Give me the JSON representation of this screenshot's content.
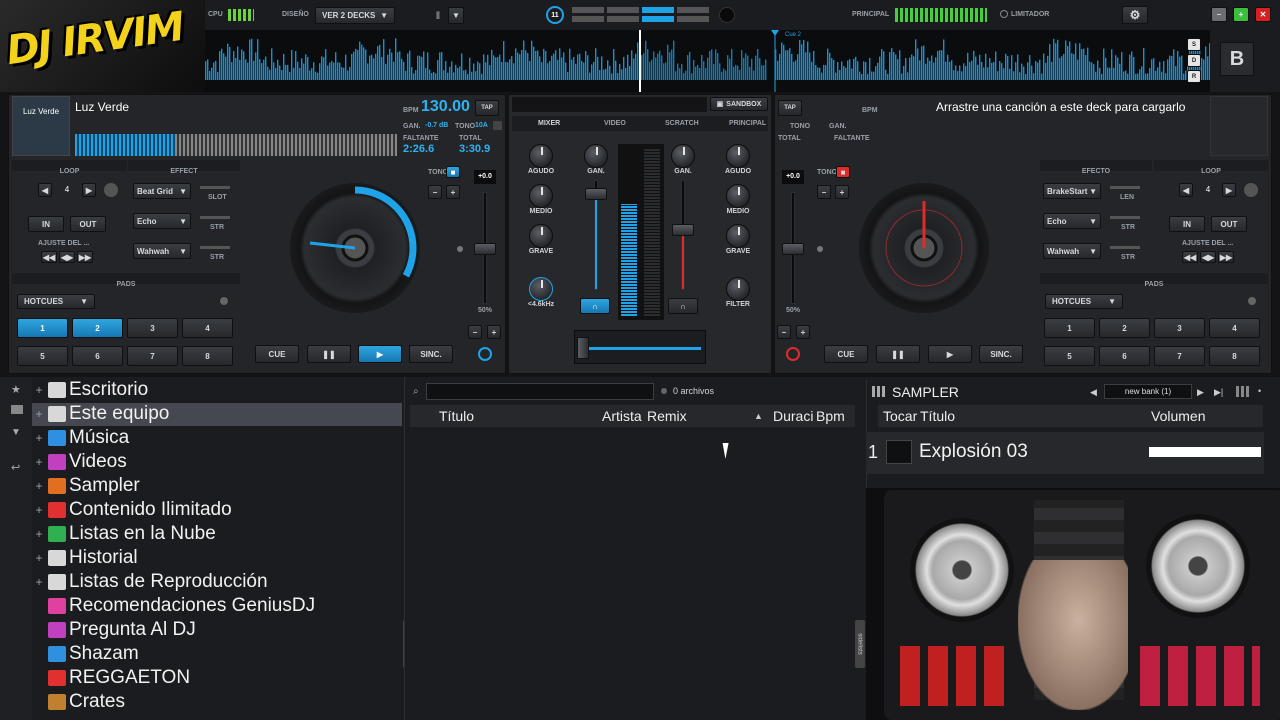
{
  "logo": {
    "text": "DJ IRVIM"
  },
  "topbar": {
    "cpu_label": "CPU",
    "design_label": "DISEÑO",
    "design_value": "VER 2 DECKS",
    "crossfader_number": "11",
    "master_label": "PRINCIPAL",
    "limiter_label": "LIMITADOR",
    "b_label": "B",
    "side_buttons": [
      "S",
      "D",
      "R"
    ],
    "cue_marker": "Cue 2"
  },
  "deck_left": {
    "cover_text": "Luz Verde",
    "title": "Luz Verde",
    "bpm_label": "BPM",
    "bpm_value": "130.00",
    "tap": "TAP",
    "gain_label": "GAN.",
    "gain_value": "-0.7 dB",
    "key_label": "TONO",
    "key_value": "10A",
    "remaining_label": "FALTANTE",
    "remaining_value": "2:26.6",
    "total_label": "TOTAL",
    "total_value": "3:30.9",
    "loop_label": "LOOP",
    "loop_value": "4",
    "in": "IN",
    "out": "OUT",
    "adjust_label": "AJUSTE DEL ...",
    "effect_label": "EFFECT",
    "effects": [
      {
        "name": "Beat Grid",
        "param": "SLOT"
      },
      {
        "name": "Echo",
        "param": "STR"
      },
      {
        "name": "Wahwah",
        "param": "STR"
      }
    ],
    "pads_label": "PADS",
    "pads_mode": "HOTCUES",
    "pads": [
      "1",
      "2",
      "3",
      "4",
      "5",
      "6",
      "7",
      "8"
    ],
    "pitch_label": "TONO",
    "pitch_value": "+0.0",
    "pitch_pct": "50%",
    "cue": "CUE",
    "pause": "❚❚",
    "play": "▶",
    "sync": "SINC."
  },
  "mixer": {
    "sandbox": "SANDBOX",
    "tabs": [
      "MIXER",
      "VIDEO",
      "SCRATCH",
      "PRINCIPAL"
    ],
    "left_knobs": [
      "AGUDO",
      "MEDIO",
      "GRAVE"
    ],
    "left_filter": "<4.6kHz",
    "gain_label": "GAN.",
    "right_knobs": [
      "AGUDO",
      "MEDIO",
      "GRAVE"
    ],
    "right_filter": "FILTER"
  },
  "deck_right": {
    "tap": "TAP",
    "bpm_label": "BPM",
    "key_label": "TONO",
    "gain_label": "GAN.",
    "total_label": "TOTAL",
    "remaining_label": "FALTANTE",
    "empty_message": "Arrastre una canción a este deck para cargarlo",
    "effect_label": "EFECTO",
    "effects": [
      {
        "name": "BrakeStart",
        "param": "LEN"
      },
      {
        "name": "Echo",
        "param": "STR"
      },
      {
        "name": "Wahwah",
        "param": "STR"
      }
    ],
    "loop_label": "LOOP",
    "loop_value": "4",
    "in": "IN",
    "out": "OUT",
    "adjust_label": "AJUSTE DEL ...",
    "pads_label": "PADS",
    "pads_mode": "HOTCUES",
    "pads": [
      "1",
      "2",
      "3",
      "4",
      "5",
      "6",
      "7",
      "8"
    ],
    "pitch_label": "TONO",
    "pitch_value": "+0.0",
    "pitch_pct": "50%",
    "cue": "CUE",
    "pause": "❚❚",
    "play": "▶",
    "sync": "SINC."
  },
  "browser": {
    "tree": [
      {
        "label": "Escritorio",
        "icon": "desktop-icon",
        "color": "#d8d8d8"
      },
      {
        "label": "Este equipo",
        "icon": "computer-icon",
        "color": "#d8d8d8"
      },
      {
        "label": "Música",
        "icon": "music-icon",
        "color": "#2f8fe0"
      },
      {
        "label": "Videos",
        "icon": "video-icon",
        "color": "#c040c0"
      },
      {
        "label": "Sampler",
        "icon": "sampler-icon",
        "color": "#e07020"
      },
      {
        "label": "Contenido Ilimitado",
        "icon": "unlimited-icon",
        "color": "#e03030"
      },
      {
        "label": "Listas en la Nube",
        "icon": "cloud-icon",
        "color": "#30b050"
      },
      {
        "label": "Historial",
        "icon": "history-icon",
        "color": "#d8d8d8"
      },
      {
        "label": "Listas de Reproducción",
        "icon": "playlist-icon",
        "color": "#d8d8d8"
      },
      {
        "label": "Recomendaciones GeniusDJ",
        "icon": "genius-icon",
        "color": "#e040a0"
      },
      {
        "label": "Pregunta Al DJ",
        "icon": "ask-dj-icon",
        "color": "#c040c0"
      },
      {
        "label": "Shazam",
        "icon": "shazam-icon",
        "color": "#3090e0"
      },
      {
        "label": "REGGAETON",
        "icon": "list-icon",
        "color": "#e03030"
      },
      {
        "label": "Crates",
        "icon": "crate-icon",
        "color": "#c08030"
      }
    ],
    "folders_tab": "folders",
    "search_placeholder": "",
    "file_count": "0 archivos",
    "columns": [
      "Título",
      "Artista",
      "Remix",
      "Duració",
      "Bpm"
    ],
    "sidelist_tab": "sidelists"
  },
  "sampler": {
    "title": "SAMPLER",
    "bank": "new bank (1)",
    "columns": [
      "Tocar",
      "Título",
      "Volumen"
    ],
    "rows": [
      {
        "index": "1",
        "title": "Explosión 03"
      }
    ]
  },
  "colors": {
    "accent": "#1fa3e8",
    "red": "#e02b2b"
  }
}
